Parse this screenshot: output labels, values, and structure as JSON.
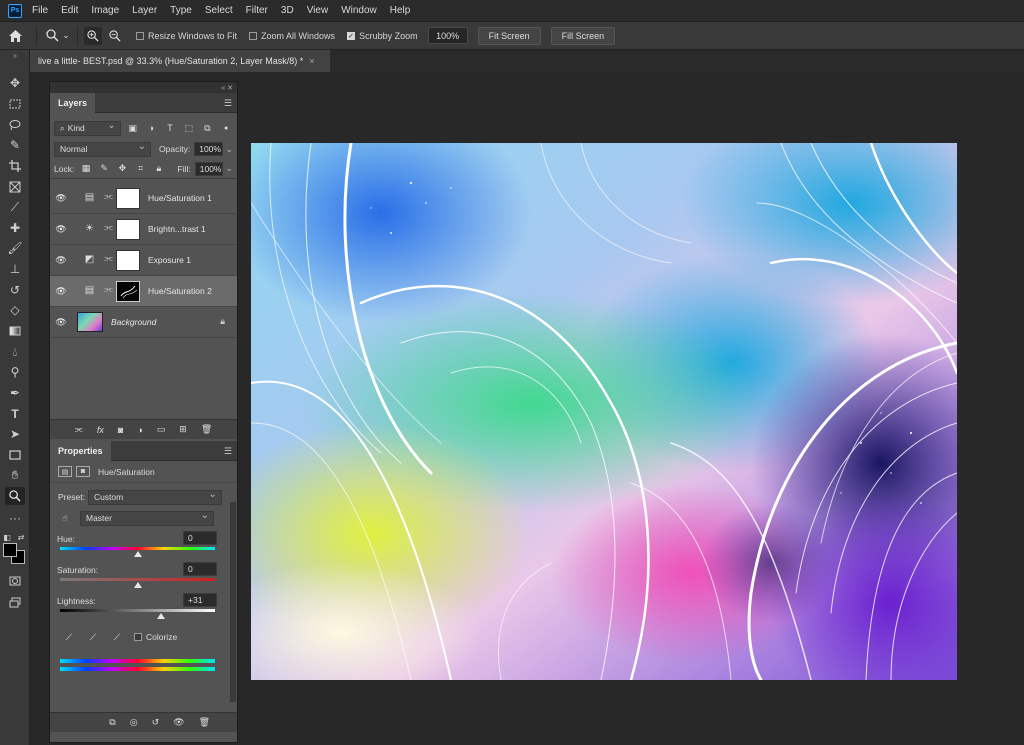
{
  "app": {
    "logo": "Ps"
  },
  "menu": [
    "File",
    "Edit",
    "Image",
    "Layer",
    "Type",
    "Select",
    "Filter",
    "3D",
    "View",
    "Window",
    "Help"
  ],
  "options": {
    "resize_windows": "Resize Windows to Fit",
    "zoom_all_windows": "Zoom All Windows",
    "scrubby_zoom": "Scrubby Zoom",
    "zoom_value": "100%",
    "fit_screen": "Fit Screen",
    "fill_screen": "Fill Screen"
  },
  "document": {
    "tab_title": "live a little- BEST.psd @ 33.3% (Hue/Saturation 2, Layer Mask/8) *",
    "close": "×"
  },
  "layers_panel": {
    "tab": "Layers",
    "kind": "Kind",
    "blend_mode": "Normal",
    "opacity_label": "Opacity:",
    "opacity_value": "100%",
    "lock_label": "Lock:",
    "fill_label": "Fill:",
    "fill_value": "100%",
    "layers": [
      {
        "name": "Hue/Saturation 1",
        "icon": "hue-sat-icon"
      },
      {
        "name": "Brightn...trast 1",
        "icon": "brightness-contrast-icon"
      },
      {
        "name": "Exposure 1",
        "icon": "exposure-icon"
      },
      {
        "name": "Hue/Saturation 2",
        "icon": "hue-sat-icon",
        "selected": true
      },
      {
        "name": "Background",
        "icon": "lock-icon"
      }
    ]
  },
  "properties_panel": {
    "tab": "Properties",
    "adjustment_title": "Hue/Saturation",
    "preset_label": "Preset:",
    "preset_value": "Custom",
    "channel_value": "Master",
    "hue_label": "Hue:",
    "hue_value": "0",
    "saturation_label": "Saturation:",
    "saturation_value": "0",
    "lightness_label": "Lightness:",
    "lightness_value": "+31",
    "colorize_label": "Colorize"
  }
}
